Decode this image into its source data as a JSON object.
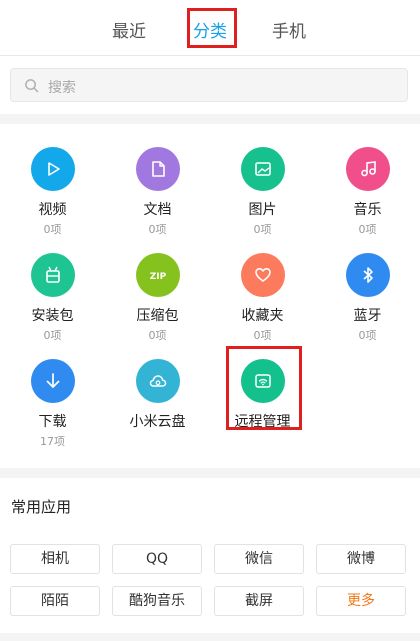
{
  "tabs": [
    {
      "label": "最近",
      "active": false
    },
    {
      "label": "分类",
      "active": true
    },
    {
      "label": "手机",
      "active": false
    }
  ],
  "search": {
    "placeholder": "搜索",
    "icon": "search-icon"
  },
  "categories": [
    {
      "name": "视频",
      "count": "0项",
      "color": "#12a8ea",
      "icon": "play-icon"
    },
    {
      "name": "文档",
      "count": "0项",
      "color": "#a178e0",
      "icon": "document-icon"
    },
    {
      "name": "图片",
      "count": "0项",
      "color": "#17c18d",
      "icon": "image-icon"
    },
    {
      "name": "音乐",
      "count": "0项",
      "color": "#f04f8c",
      "icon": "music-icon"
    },
    {
      "name": "安装包",
      "count": "0项",
      "color": "#1fc493",
      "icon": "android-icon"
    },
    {
      "name": "压缩包",
      "count": "0项",
      "color": "#86c21d",
      "icon": "zip-icon"
    },
    {
      "name": "收藏夹",
      "count": "0项",
      "color": "#fb7b5c",
      "icon": "heart-icon"
    },
    {
      "name": "蓝牙",
      "count": "0项",
      "color": "#2f8bf0",
      "icon": "bluetooth-icon"
    },
    {
      "name": "下载",
      "count": "17项",
      "color": "#2f8bf0",
      "icon": "download-icon"
    },
    {
      "name": "小米云盘",
      "count": "",
      "color": "#34b4d4",
      "icon": "cloud-icon"
    },
    {
      "name": "远程管理",
      "count": "",
      "color": "#14c08c",
      "icon": "remote-wifi-icon"
    }
  ],
  "apps_section": {
    "title": "常用应用",
    "items": [
      "相机",
      "QQ",
      "微信",
      "微博",
      "陌陌",
      "酷狗音乐",
      "截屏",
      "更多"
    ],
    "more_color": "#f07a1a"
  },
  "colors": {
    "accent": "#1aa0e8",
    "highlight": "#e0201f"
  }
}
